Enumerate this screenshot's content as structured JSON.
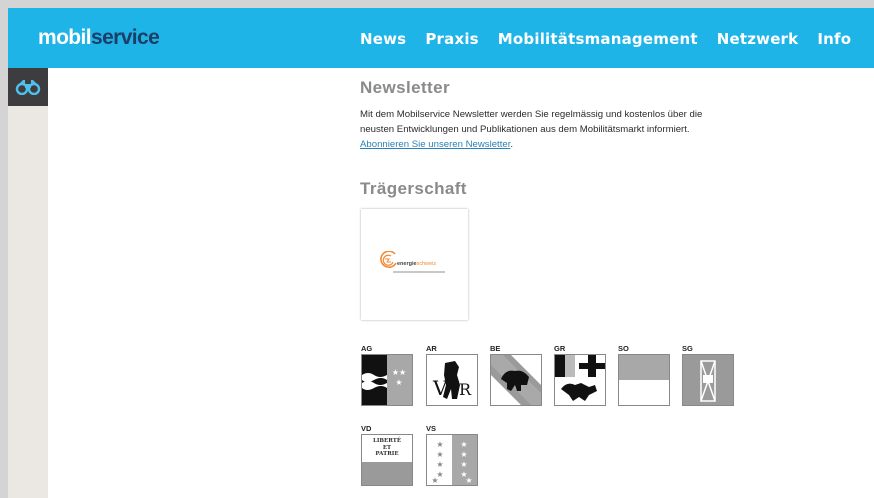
{
  "header": {
    "logo_part1": "mobil",
    "logo_part2": "service",
    "nav": [
      "News",
      "Praxis",
      "Mobilitätsmanagement",
      "Netzwerk",
      "Info"
    ]
  },
  "sidebar": {
    "tool_icon": "binoculars-icon"
  },
  "newsletter": {
    "heading": "Newsletter",
    "text_line1": "Mit dem Mobilservice Newsletter werden Sie regelmässig und kostenlos über die",
    "text_line2": "neusten Entwicklungen und Publikationen aus dem Mobilitätsmarkt informiert.",
    "link_text": "Abonnieren Sie unseren Newsletter",
    "link_suffix": "."
  },
  "traegerschaft": {
    "heading": "Trägerschaft",
    "logo_word1": "energie",
    "logo_word2": "schweiz"
  },
  "cantons": [
    {
      "code": "AG",
      "icon": "aargau-crest-icon"
    },
    {
      "code": "AR",
      "icon": "appenzell-ausserrhoden-crest-icon"
    },
    {
      "code": "BE",
      "icon": "bern-crest-icon"
    },
    {
      "code": "GR",
      "icon": "graubuenden-crest-icon"
    },
    {
      "code": "SO",
      "icon": "solothurn-crest-icon"
    },
    {
      "code": "SG",
      "icon": "st-gallen-crest-icon"
    },
    {
      "code": "VD",
      "icon": "vaud-crest-icon",
      "motto": [
        "LIBERTÉ",
        "ET",
        "PATRIE"
      ]
    },
    {
      "code": "VS",
      "icon": "valais-crest-icon"
    }
  ],
  "colors": {
    "brand": "#1fb4e8",
    "logo_dark": "#1b3f66",
    "link": "#2b83b5"
  }
}
